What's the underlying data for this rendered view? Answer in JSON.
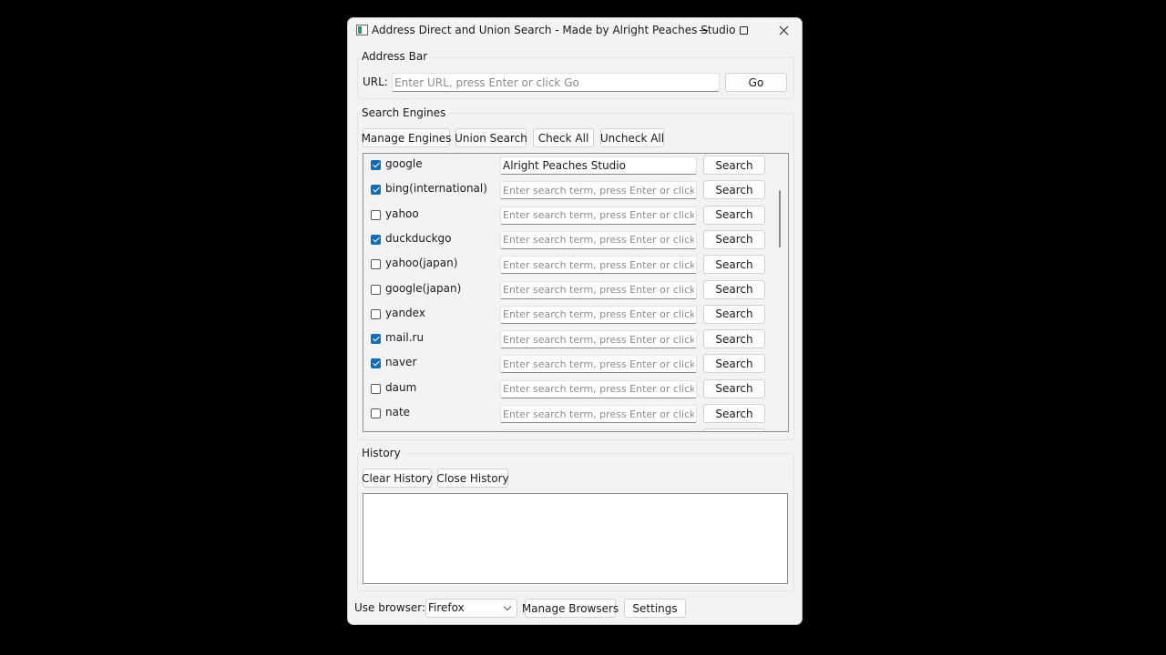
{
  "window": {
    "title": "Address Direct and Union Search - Made by Alright Peaches Studio"
  },
  "address_bar": {
    "group_title": "Address Bar",
    "url_label": "URL:",
    "url_value": "",
    "url_placeholder": "Enter URL, press Enter or click Go",
    "go_label": "Go"
  },
  "search_engines": {
    "group_title": "Search Engines",
    "buttons": {
      "manage": "Manage Engines",
      "union": "Union Search",
      "check_all": "Check All",
      "uncheck_all": "Uncheck All"
    },
    "search_placeholder": "Enter search term, press Enter or click...",
    "search_label": "Search",
    "engines": [
      {
        "name": "google",
        "checked": true,
        "term": "Alright Peaches Studio"
      },
      {
        "name": "bing(international)",
        "checked": true,
        "term": ""
      },
      {
        "name": "yahoo",
        "checked": false,
        "term": ""
      },
      {
        "name": "duckduckgo",
        "checked": true,
        "term": ""
      },
      {
        "name": "yahoo(japan)",
        "checked": false,
        "term": ""
      },
      {
        "name": "google(japan)",
        "checked": false,
        "term": ""
      },
      {
        "name": "yandex",
        "checked": false,
        "term": ""
      },
      {
        "name": "mail.ru",
        "checked": true,
        "term": ""
      },
      {
        "name": "naver",
        "checked": true,
        "term": ""
      },
      {
        "name": "daum",
        "checked": false,
        "term": ""
      },
      {
        "name": "nate",
        "checked": false,
        "term": ""
      }
    ]
  },
  "history": {
    "group_title": "History",
    "clear_label": "Clear History",
    "close_label": "Close History"
  },
  "footer": {
    "use_browser_label": "Use browser:",
    "browser_selected": "Firefox",
    "manage_browsers_label": "Manage Browsers",
    "settings_label": "Settings"
  }
}
